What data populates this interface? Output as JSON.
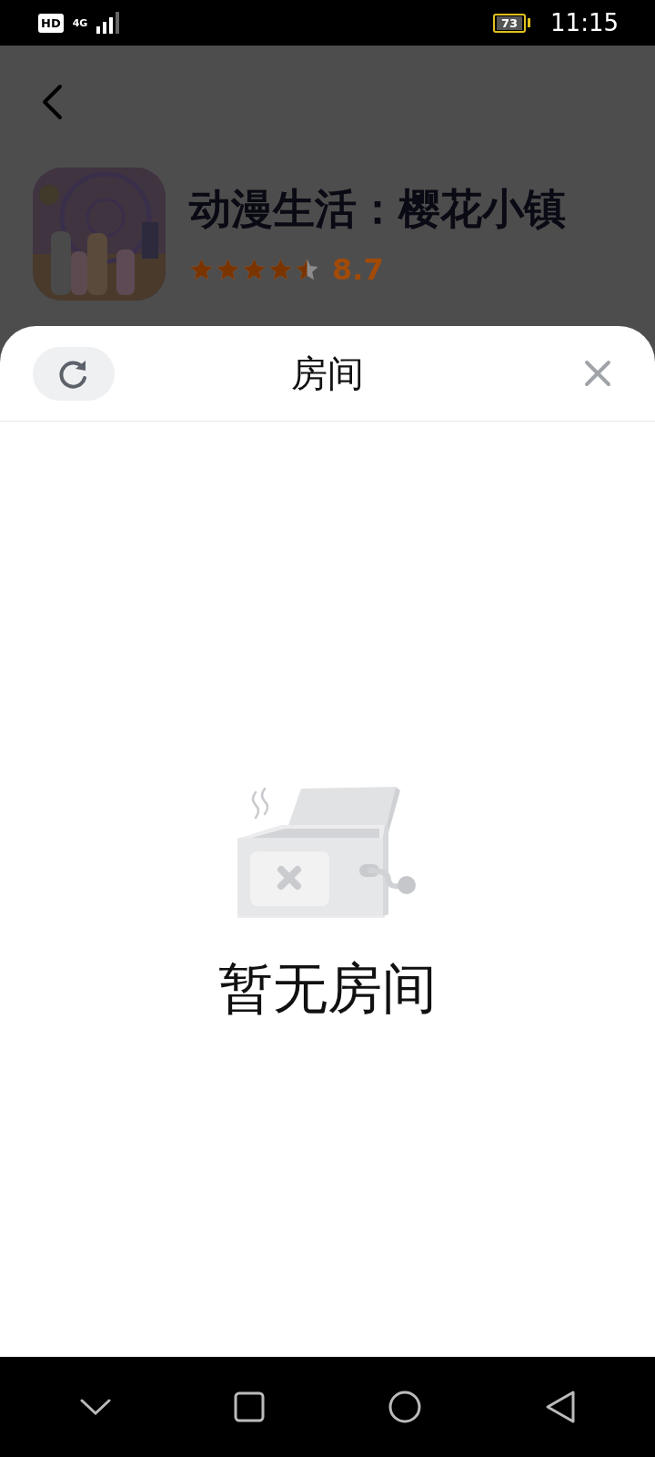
{
  "status_bar": {
    "hd": "HD",
    "network": "4G",
    "battery": "73",
    "time": "11:15"
  },
  "app": {
    "title": "动漫生活：樱花小镇",
    "stars": 4.5,
    "rating": "8.7"
  },
  "sheet": {
    "title": "房间",
    "empty_text": "暂无房间"
  }
}
